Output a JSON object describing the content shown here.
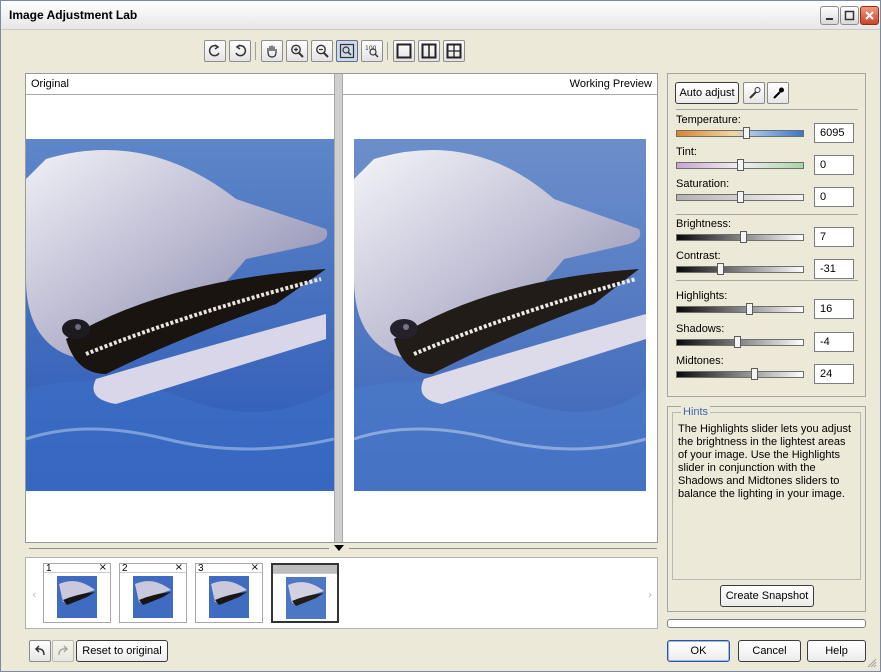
{
  "window": {
    "title": "Image Adjustment Lab"
  },
  "panes": {
    "original_label": "Original",
    "preview_label": "Working Preview"
  },
  "toolbar": {
    "buttons": [
      "rotate-left-icon",
      "rotate-right-icon",
      "hand-tool-icon",
      "zoom-in-icon",
      "zoom-out-icon",
      "zoom-to-fit-icon",
      "zoom-100-icon",
      "single-pane-icon",
      "split-view-icon",
      "before-after-icon"
    ],
    "zoom_100_text": "100"
  },
  "adjust": {
    "auto_adjust": "Auto adjust",
    "white_point_icon": "white-eyedropper-icon",
    "black_point_icon": "black-eyedropper-icon",
    "sliders": [
      {
        "id": "temperature",
        "label": "Temperature:",
        "value": "6095",
        "level": 0.55
      },
      {
        "id": "tint",
        "label": "Tint:",
        "value": "0",
        "level": 0.5
      },
      {
        "id": "saturation",
        "label": "Saturation:",
        "value": "0",
        "level": 0.5
      },
      {
        "id": "brightness",
        "label": "Brightness:",
        "value": "7",
        "level": 0.53
      },
      {
        "id": "contrast",
        "label": "Contrast:",
        "value": "-31",
        "level": 0.34
      },
      {
        "id": "highlights",
        "label": "Highlights:",
        "value": "16",
        "level": 0.58
      },
      {
        "id": "shadows",
        "label": "Shadows:",
        "value": "-4",
        "level": 0.48
      },
      {
        "id": "midtones",
        "label": "Midtones:",
        "value": "24",
        "level": 0.62
      }
    ]
  },
  "hints": {
    "title": "Hints",
    "text": "The Highlights slider lets you adjust the brightness in the lightest areas of your image. Use the Highlights slider in conjunction with the Shadows and Midtones sliders to balance the lighting in your image."
  },
  "snapshots": {
    "items": [
      {
        "number": "1",
        "close": "×"
      },
      {
        "number": "2",
        "close": "×"
      },
      {
        "number": "3",
        "close": "×"
      },
      {
        "number": "",
        "close": ""
      }
    ],
    "create_label": "Create Snapshot"
  },
  "footer": {
    "undo_icon": "undo-icon",
    "redo_icon": "redo-icon",
    "reset": "Reset to original",
    "ok": "OK",
    "cancel": "Cancel",
    "help": "Help"
  },
  "colors": {
    "accent": "#2c54a8",
    "hints_title": "#3e67b1",
    "close_button": "#c8442a"
  }
}
